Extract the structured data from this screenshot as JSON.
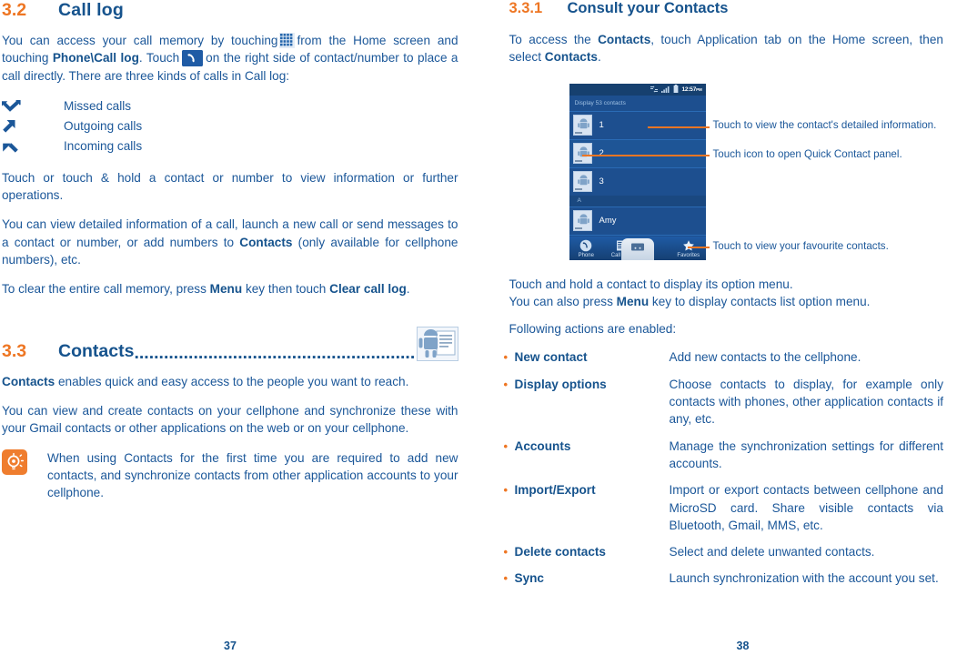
{
  "colors": {
    "heading_orange": "#ee7623",
    "heading_blue": "#16538d",
    "body_blue": "#1b5799",
    "phone_bg": "#1d4f8f",
    "leader_orange": "#ee7623"
  },
  "left_page": {
    "number": "37",
    "section": {
      "num": "3.2",
      "title": "Call log"
    },
    "intro_parts": {
      "p1_a": "You can access your call memory by touching",
      "p1_b": "from the Home screen and touching",
      "p1_bold1": "Phone\\Call log",
      "p1_c": ". Touch",
      "p1_d": "on the right side of contact/number to place a call directly. There are three kinds of calls in Call log:"
    },
    "call_types": [
      {
        "icon": "missed-call-icon",
        "label": "Missed calls"
      },
      {
        "icon": "outgoing-call-icon",
        "label": "Outgoing calls"
      },
      {
        "icon": "incoming-call-icon",
        "label": "Incoming calls"
      }
    ],
    "p2": "Touch or touch & hold a contact or number to view information or further operations.",
    "p3_parts": {
      "a": "You can view detailed information of a call, launch a new call or send messages to a contact or number, or add numbers to ",
      "bold": "Contacts",
      "b": " (only available for cellphone numbers), etc."
    },
    "p4_parts": {
      "a": "To clear the entire call memory, press ",
      "bold1": "Menu",
      "b": " key then touch ",
      "bold2": "Clear call log",
      "c": "."
    },
    "contacts_section": {
      "num": "3.3",
      "title": "Contacts",
      "dots": "............................................................................",
      "icon": "contacts-app-icon"
    },
    "c_p1_parts": {
      "bold": "Contacts",
      "rest": " enables quick and easy access to the people you want to reach."
    },
    "c_p2": "You can view and create contacts on your cellphone and synchronize these with your Gmail contacts or other applications on the web or on your cellphone.",
    "tip": {
      "icon": "tip-bulb-icon",
      "text": "When using Contacts for the first time you are required to add new contacts, and synchronize contacts from other application accounts to your cellphone."
    }
  },
  "right_page": {
    "number": "38",
    "subsection": {
      "num": "3.3.1",
      "title": "Consult your Contacts"
    },
    "p1_parts": {
      "a": "To access the ",
      "bold1": "Contacts",
      "b": ", touch Application tab on the Home screen, then select ",
      "bold2": "Contacts",
      "c": "."
    },
    "figure": {
      "statusbar": {
        "time": "12:57",
        "meridiem": "PM",
        "icons": [
          "sync-icon",
          "signal-icon",
          "battery-icon"
        ]
      },
      "titlebar": "Display 53 contacts",
      "rows": [
        {
          "name": "1",
          "avatar": "android-avatar"
        },
        {
          "name": "2",
          "avatar": "android-avatar"
        },
        {
          "name": "3",
          "avatar": "android-avatar"
        }
      ],
      "index_letter": "A",
      "row_after_index": {
        "name": "Amy",
        "avatar": "android-avatar"
      },
      "nav": [
        {
          "icon": "phone-icon",
          "label": "Phone"
        },
        {
          "icon": "call-log-icon",
          "label": "Call log"
        },
        {
          "icon": "contacts-icon",
          "label": ""
        },
        {
          "icon": "star-icon",
          "label": "Favorites"
        }
      ],
      "annotations": [
        {
          "text": "Touch to view the contact's detailed information."
        },
        {
          "text": "Touch icon to open Quick Contact panel."
        },
        {
          "text": "Touch to view your favourite contacts."
        }
      ]
    },
    "p2_line1": "Touch and hold a contact to display its option menu.",
    "p2_line2_parts": {
      "a": "You can also press ",
      "bold": "Menu",
      "b": " key to display contacts list option menu."
    },
    "p3": "Following actions are enabled:",
    "actions": [
      {
        "term": "New contact",
        "desc": "Add new contacts to the cellphone."
      },
      {
        "term": "Display options",
        "desc": "Choose contacts to display, for example only contacts with phones, other application contacts if any, etc."
      },
      {
        "term": "Accounts",
        "desc": "Manage the synchronization settings for different accounts."
      },
      {
        "term": "Import/Export",
        "desc": "Import or export contacts between cellphone and MicroSD card. Share visible contacts via Bluetooth, Gmail, MMS, etc."
      },
      {
        "term": "Delete contacts",
        "desc": "Select and delete unwanted contacts."
      },
      {
        "term": "Sync",
        "desc": "Launch synchronization with the account you set."
      }
    ]
  }
}
